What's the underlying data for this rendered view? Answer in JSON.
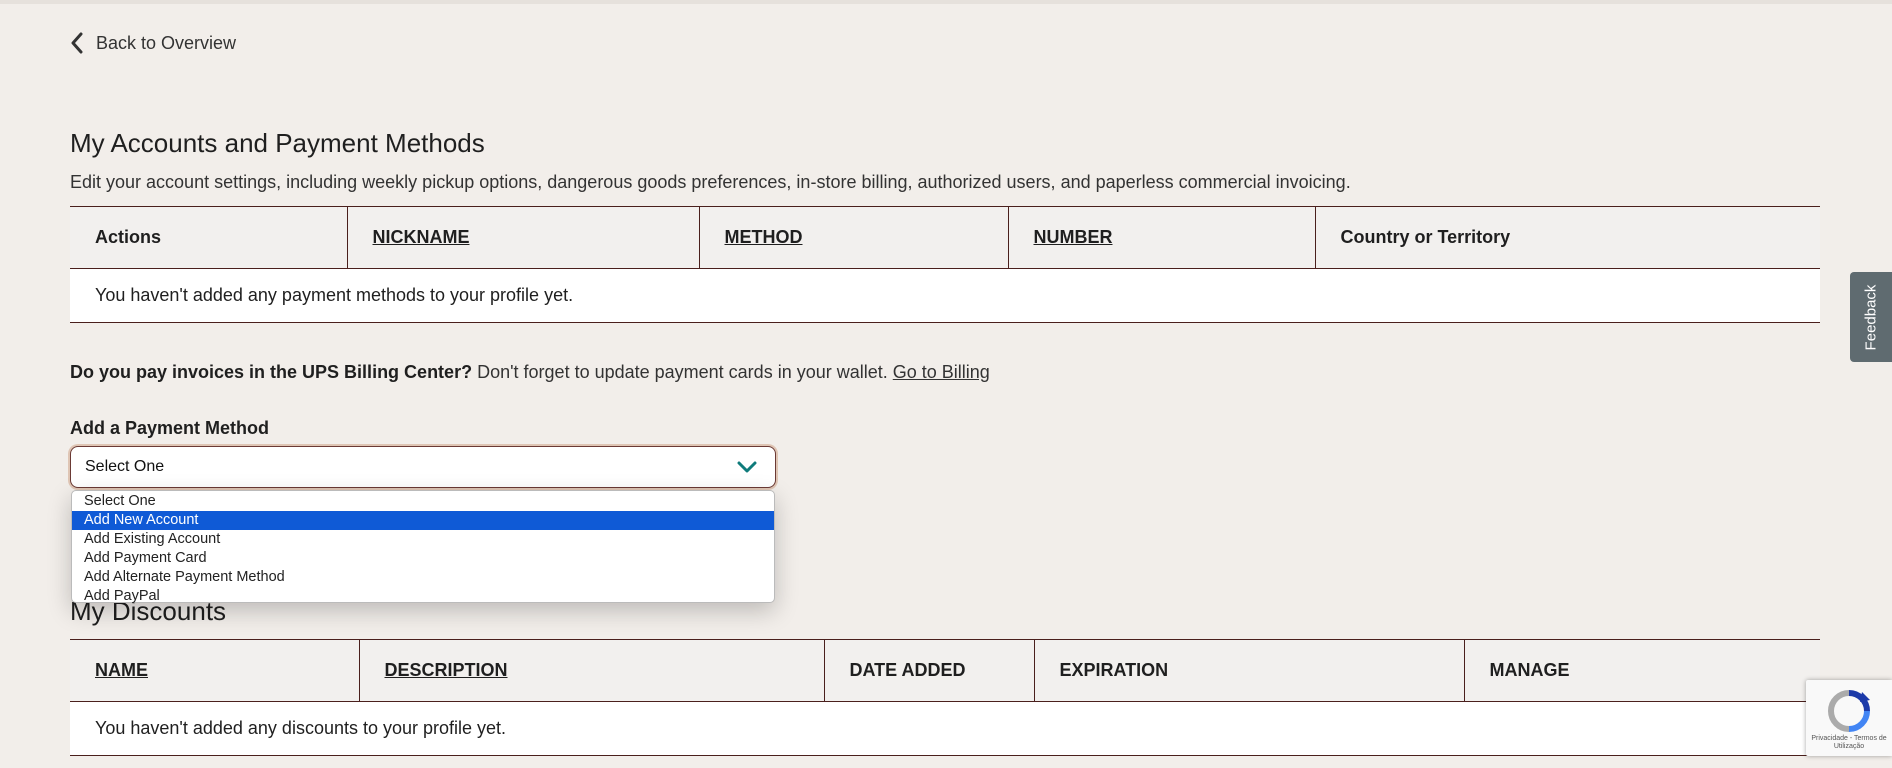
{
  "nav": {
    "back_label": "Back to Overview"
  },
  "accounts": {
    "title": "My Accounts and Payment Methods",
    "description": "Edit your account settings, including weekly pickup options, dangerous goods preferences, in-store billing, authorized users, and paperless commercial invoicing.",
    "columns": [
      "Actions",
      "NICKNAME",
      "METHOD",
      "NUMBER",
      "Country or Territory"
    ],
    "empty_message": "You haven't added any payment methods to your profile yet."
  },
  "billing": {
    "question": "Do you pay invoices in the UPS Billing Center?",
    "reminder": " Don't forget to update payment cards in your wallet. ",
    "link": "Go to Billing"
  },
  "payment_method": {
    "label": "Add a Payment Method",
    "selected_value": "Select One",
    "options": [
      "Select One",
      "Add New Account",
      "Add Existing Account",
      "Add Payment Card",
      "Add Alternate Payment Method",
      "Add PayPal"
    ],
    "highlighted_index": 1
  },
  "discounts": {
    "title": "My Discounts",
    "columns": [
      "NAME",
      "DESCRIPTION",
      "DATE ADDED",
      "EXPIRATION",
      "MANAGE"
    ],
    "empty_message": "You haven't added any discounts to your profile yet."
  },
  "feedback": {
    "label": "Feedback"
  },
  "recaptcha": {
    "privacy": "Privacidade",
    "terms": "Termos de Utilização"
  },
  "colors": {
    "accent": "#0f5ad6",
    "border": "#4a1f1c",
    "chevron": "#0f7b7b",
    "background": "#f2eeea"
  },
  "icons": [
    "chevron-left-icon",
    "chevron-down-icon",
    "recaptcha-icon"
  ]
}
